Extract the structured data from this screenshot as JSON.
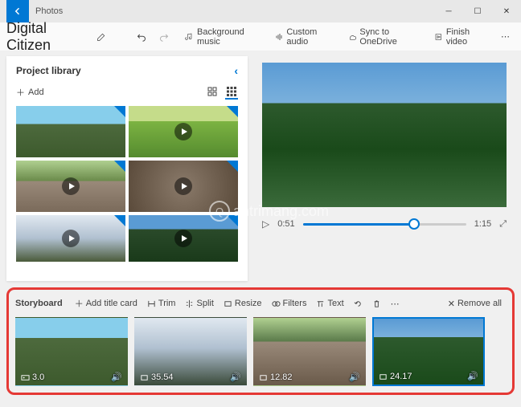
{
  "app_title": "Photos",
  "project_title": "Digital Citizen",
  "toolbar": {
    "bg_music": "Background music",
    "custom_audio": "Custom audio",
    "sync": "Sync to OneDrive",
    "finish": "Finish video"
  },
  "library": {
    "title": "Project library",
    "add": "Add"
  },
  "preview": {
    "current_time": "0:51",
    "total_time": "1:15"
  },
  "storyboard": {
    "title": "Storyboard",
    "add_title": "Add title card",
    "trim": "Trim",
    "split": "Split",
    "resize": "Resize",
    "filters": "Filters",
    "text": "Text",
    "remove_all": "Remove all",
    "clips": [
      {
        "duration": "3.0",
        "selected": false
      },
      {
        "duration": "35.54",
        "selected": false
      },
      {
        "duration": "12.82",
        "selected": false
      },
      {
        "duration": "24.17",
        "selected": true
      }
    ]
  },
  "watermark": "antrimang.com"
}
